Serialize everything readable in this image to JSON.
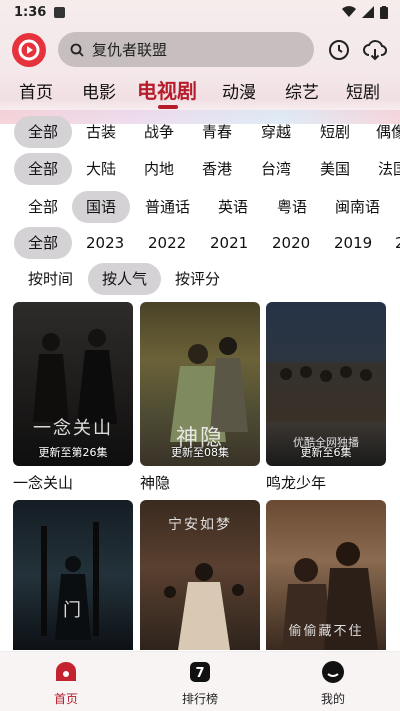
{
  "status": {
    "time": "1:36"
  },
  "search": {
    "placeholder": "复仇者联盟"
  },
  "tabs": [
    "首页",
    "电影",
    "电视剧",
    "动漫",
    "综艺",
    "短剧"
  ],
  "filters": {
    "genre": [
      "全部",
      "古装",
      "战争",
      "青春",
      "穿越",
      "短剧",
      "偶像"
    ],
    "region": [
      "全部",
      "大陆",
      "内地",
      "香港",
      "台湾",
      "美国",
      "法国"
    ],
    "language": [
      "全部",
      "国语",
      "普通话",
      "英语",
      "粤语",
      "闽南语"
    ],
    "year": [
      "全部",
      "2023",
      "2022",
      "2021",
      "2020",
      "2019",
      "2"
    ],
    "sort": [
      "按时间",
      "按人气",
      "按评分"
    ]
  },
  "cards": [
    {
      "title": "一念关山",
      "caption": "更新至第26集",
      "art": "一念关山"
    },
    {
      "title": "神隐",
      "caption": "更新至08集",
      "art": "神隐"
    },
    {
      "title": "鸣龙少年",
      "caption": "更新至6集",
      "art": "优酷全网独播"
    },
    {
      "title": "",
      "caption": "",
      "art": "门"
    },
    {
      "title": "",
      "caption": "",
      "art": "宁安如梦"
    },
    {
      "title": "",
      "caption": "",
      "art": "偷偷藏不住"
    }
  ],
  "bottom_nav": [
    "首页",
    "排行榜",
    "我的"
  ],
  "colors": {
    "accent": "#b51d2b",
    "logo": "#e5323d",
    "chip_selected": "#d4d2d4"
  }
}
